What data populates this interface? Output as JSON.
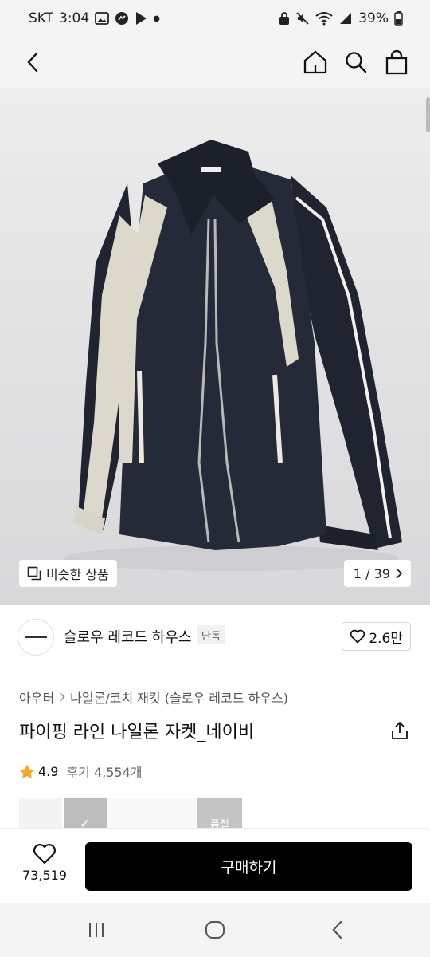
{
  "status_bar": {
    "carrier": "SKT",
    "time": "3:04",
    "battery": "39%",
    "icons_left": [
      "gallery-icon",
      "messenger-icon",
      "play-store-icon",
      "dot-icon"
    ],
    "icons_right": [
      "lock-icon",
      "mute-icon",
      "wifi-icon",
      "signal-icon",
      "battery-icon"
    ]
  },
  "header": {
    "back_icon": "chevron-left-icon",
    "actions": [
      "home-icon",
      "search-icon",
      "shopping-bag-icon"
    ]
  },
  "gallery": {
    "similar_label": "비슷한 상품",
    "counter": "1 / 39"
  },
  "brand": {
    "name": "슬로우 레코드 하우스",
    "badge": "단독",
    "likes": "2.6만"
  },
  "product": {
    "breadcrumb": [
      "아우터",
      "나일론/코치 재킷 (슬로우 레코드 하우스)"
    ],
    "title": "파이핑 라인 나일론 자켓_네이비",
    "rating": "4.9",
    "reviews": "후기 4,554개",
    "rating_fraction": 0.98
  },
  "thumbs": {
    "check": "✓",
    "sold_out": "품절"
  },
  "action_bar": {
    "wish_count": "73,519",
    "buy_label": "구매하기"
  },
  "system_nav": [
    "recent-apps-icon",
    "home-circle-icon",
    "back-icon"
  ],
  "colors": {
    "status_bg": "#f4f4f4",
    "image_bg": "#dcdcdc",
    "buy_button": "#000000",
    "star": "#f5a623"
  }
}
